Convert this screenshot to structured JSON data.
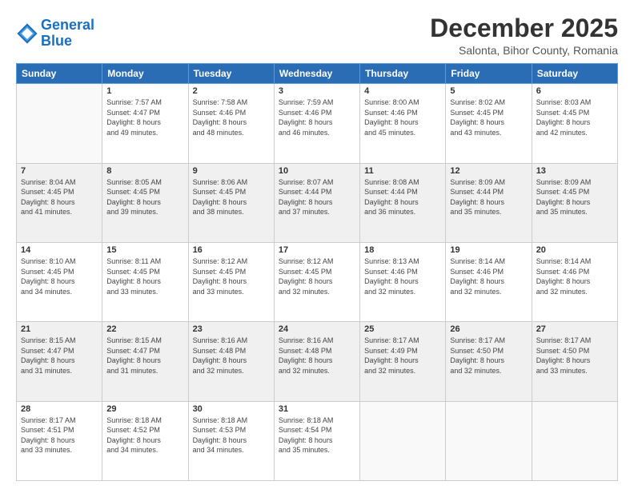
{
  "logo": {
    "text_general": "General",
    "text_blue": "Blue"
  },
  "header": {
    "title": "December 2025",
    "subtitle": "Salonta, Bihor County, Romania"
  },
  "weekdays": [
    "Sunday",
    "Monday",
    "Tuesday",
    "Wednesday",
    "Thursday",
    "Friday",
    "Saturday"
  ],
  "weeks": [
    [
      {
        "day": "",
        "sunrise": "",
        "sunset": "",
        "daylight": ""
      },
      {
        "day": "1",
        "sunrise": "7:57 AM",
        "sunset": "4:47 PM",
        "daylight": "8 hours and 49 minutes."
      },
      {
        "day": "2",
        "sunrise": "7:58 AM",
        "sunset": "4:46 PM",
        "daylight": "8 hours and 48 minutes."
      },
      {
        "day": "3",
        "sunrise": "7:59 AM",
        "sunset": "4:46 PM",
        "daylight": "8 hours and 46 minutes."
      },
      {
        "day": "4",
        "sunrise": "8:00 AM",
        "sunset": "4:46 PM",
        "daylight": "8 hours and 45 minutes."
      },
      {
        "day": "5",
        "sunrise": "8:02 AM",
        "sunset": "4:45 PM",
        "daylight": "8 hours and 43 minutes."
      },
      {
        "day": "6",
        "sunrise": "8:03 AM",
        "sunset": "4:45 PM",
        "daylight": "8 hours and 42 minutes."
      }
    ],
    [
      {
        "day": "7",
        "sunrise": "8:04 AM",
        "sunset": "4:45 PM",
        "daylight": "8 hours and 41 minutes."
      },
      {
        "day": "8",
        "sunrise": "8:05 AM",
        "sunset": "4:45 PM",
        "daylight": "8 hours and 39 minutes."
      },
      {
        "day": "9",
        "sunrise": "8:06 AM",
        "sunset": "4:45 PM",
        "daylight": "8 hours and 38 minutes."
      },
      {
        "day": "10",
        "sunrise": "8:07 AM",
        "sunset": "4:44 PM",
        "daylight": "8 hours and 37 minutes."
      },
      {
        "day": "11",
        "sunrise": "8:08 AM",
        "sunset": "4:44 PM",
        "daylight": "8 hours and 36 minutes."
      },
      {
        "day": "12",
        "sunrise": "8:09 AM",
        "sunset": "4:44 PM",
        "daylight": "8 hours and 35 minutes."
      },
      {
        "day": "13",
        "sunrise": "8:09 AM",
        "sunset": "4:45 PM",
        "daylight": "8 hours and 35 minutes."
      }
    ],
    [
      {
        "day": "14",
        "sunrise": "8:10 AM",
        "sunset": "4:45 PM",
        "daylight": "8 hours and 34 minutes."
      },
      {
        "day": "15",
        "sunrise": "8:11 AM",
        "sunset": "4:45 PM",
        "daylight": "8 hours and 33 minutes."
      },
      {
        "day": "16",
        "sunrise": "8:12 AM",
        "sunset": "4:45 PM",
        "daylight": "8 hours and 33 minutes."
      },
      {
        "day": "17",
        "sunrise": "8:12 AM",
        "sunset": "4:45 PM",
        "daylight": "8 hours and 32 minutes."
      },
      {
        "day": "18",
        "sunrise": "8:13 AM",
        "sunset": "4:46 PM",
        "daylight": "8 hours and 32 minutes."
      },
      {
        "day": "19",
        "sunrise": "8:14 AM",
        "sunset": "4:46 PM",
        "daylight": "8 hours and 32 minutes."
      },
      {
        "day": "20",
        "sunrise": "8:14 AM",
        "sunset": "4:46 PM",
        "daylight": "8 hours and 32 minutes."
      }
    ],
    [
      {
        "day": "21",
        "sunrise": "8:15 AM",
        "sunset": "4:47 PM",
        "daylight": "8 hours and 31 minutes."
      },
      {
        "day": "22",
        "sunrise": "8:15 AM",
        "sunset": "4:47 PM",
        "daylight": "8 hours and 31 minutes."
      },
      {
        "day": "23",
        "sunrise": "8:16 AM",
        "sunset": "4:48 PM",
        "daylight": "8 hours and 32 minutes."
      },
      {
        "day": "24",
        "sunrise": "8:16 AM",
        "sunset": "4:48 PM",
        "daylight": "8 hours and 32 minutes."
      },
      {
        "day": "25",
        "sunrise": "8:17 AM",
        "sunset": "4:49 PM",
        "daylight": "8 hours and 32 minutes."
      },
      {
        "day": "26",
        "sunrise": "8:17 AM",
        "sunset": "4:50 PM",
        "daylight": "8 hours and 32 minutes."
      },
      {
        "day": "27",
        "sunrise": "8:17 AM",
        "sunset": "4:50 PM",
        "daylight": "8 hours and 33 minutes."
      }
    ],
    [
      {
        "day": "28",
        "sunrise": "8:17 AM",
        "sunset": "4:51 PM",
        "daylight": "8 hours and 33 minutes."
      },
      {
        "day": "29",
        "sunrise": "8:18 AM",
        "sunset": "4:52 PM",
        "daylight": "8 hours and 34 minutes."
      },
      {
        "day": "30",
        "sunrise": "8:18 AM",
        "sunset": "4:53 PM",
        "daylight": "8 hours and 34 minutes."
      },
      {
        "day": "31",
        "sunrise": "8:18 AM",
        "sunset": "4:54 PM",
        "daylight": "8 hours and 35 minutes."
      },
      {
        "day": "",
        "sunrise": "",
        "sunset": "",
        "daylight": ""
      },
      {
        "day": "",
        "sunrise": "",
        "sunset": "",
        "daylight": ""
      },
      {
        "day": "",
        "sunrise": "",
        "sunset": "",
        "daylight": ""
      }
    ]
  ]
}
